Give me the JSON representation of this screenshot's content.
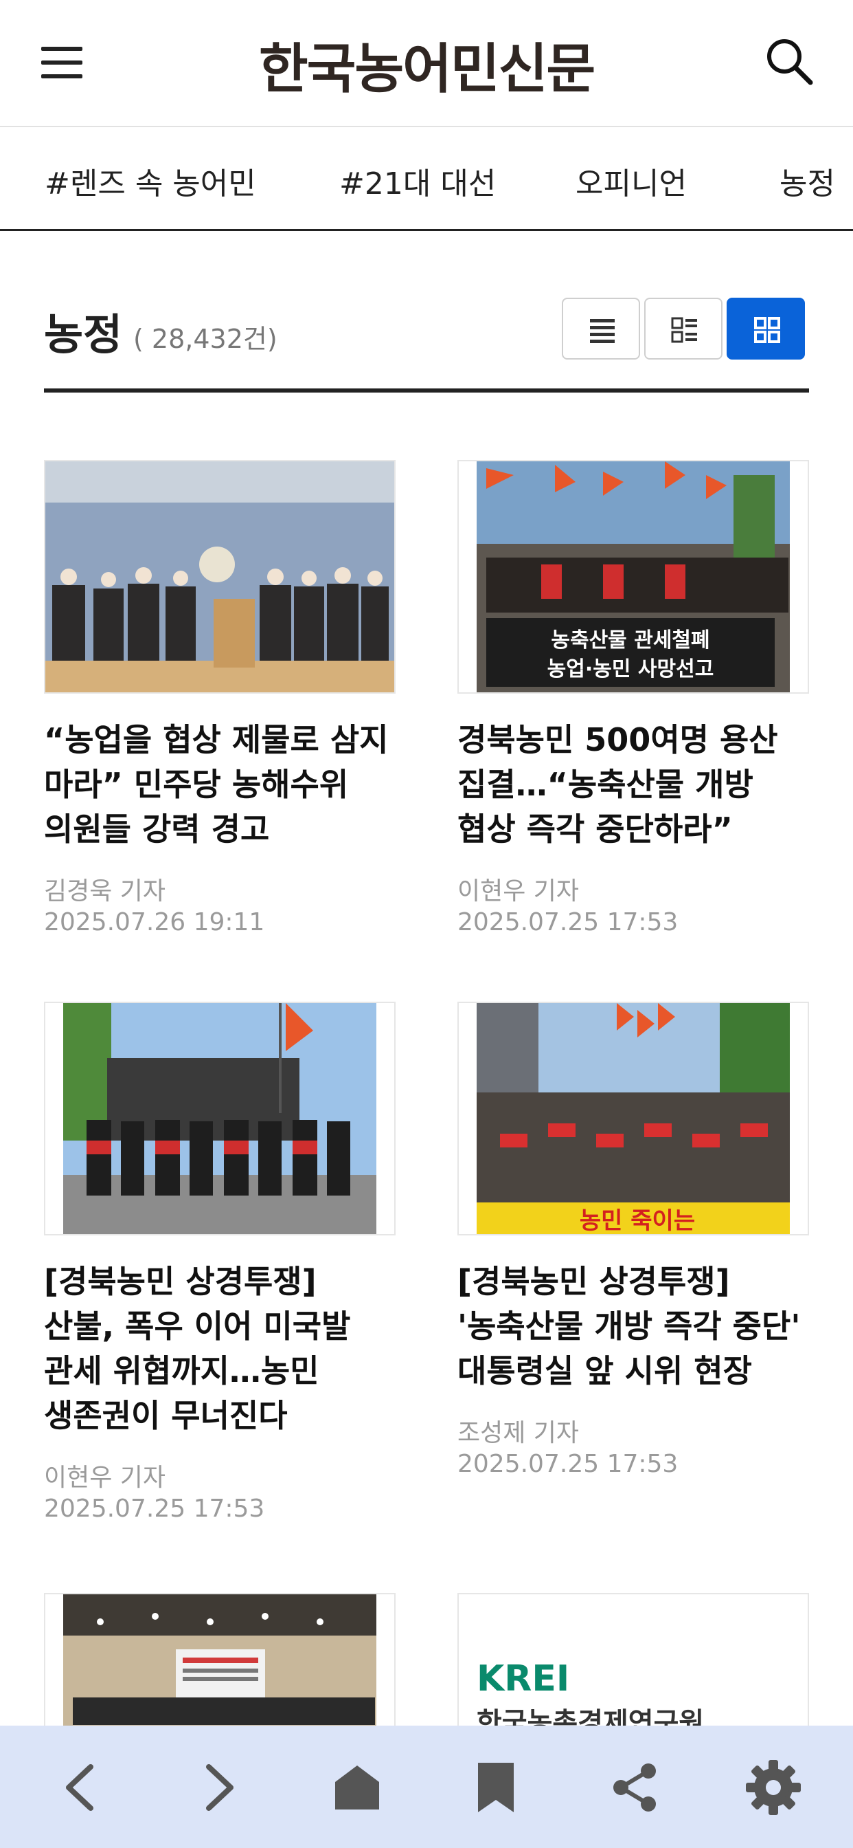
{
  "header": {
    "logo": "한국농어민신문",
    "menu_icon": "hamburger-menu-icon",
    "search_icon": "search-icon"
  },
  "tabs": [
    "#렌즈 속 농어민",
    "#21대 대선",
    "오피니언",
    "농정"
  ],
  "section": {
    "title": "농정",
    "count": "( 28,432건)",
    "view_modes": [
      "list-view-icon",
      "thumbnail-list-view-icon",
      "grid-view-icon"
    ],
    "active_view": "grid-view-icon"
  },
  "articles": [
    {
      "title": "“농업을 협상 제물로 삼지 마라” 민주당 농해수위 의원들 강력 경고",
      "author": "김경욱 기자",
      "date": "2025.07.26 19:11"
    },
    {
      "title": "경북농민 500여명 용산 집결…“농축산물 개방 협상 즉각 중단하라”",
      "author": "이현우 기자",
      "date": "2025.07.25 17:53",
      "banner_text": "농축산물 관세철폐 농업·농민 사망선고"
    },
    {
      "title": "[경북농민 상경투쟁] 산불, 폭우 이어 미국발 관세 위협까지…농민 생존권이 무너진다",
      "author": "이현우 기자",
      "date": "2025.07.25 17:53"
    },
    {
      "title": "[경북농민 상경투쟁] '농축산물 개방 즉각 중단' 대통령실 앞 시위 현장",
      "author": "조성제 기자",
      "date": "2025.07.25 17:53",
      "banner_text": "농민 죽이는"
    },
    {
      "title": "",
      "author": "",
      "date": ""
    },
    {
      "title": "",
      "author": "",
      "date": "",
      "logo_text": "KREI",
      "logo_subtext": "한국농촌경제연구원"
    }
  ],
  "bottom_nav": [
    "back-icon",
    "forward-icon",
    "home-icon",
    "bookmark-icon",
    "share-icon",
    "settings-icon"
  ],
  "colors": {
    "accent": "#0a63d9",
    "nav_bg": "#dbe4f8",
    "protest_orange": "#e8572a",
    "krei_green": "#0a8a6c"
  }
}
